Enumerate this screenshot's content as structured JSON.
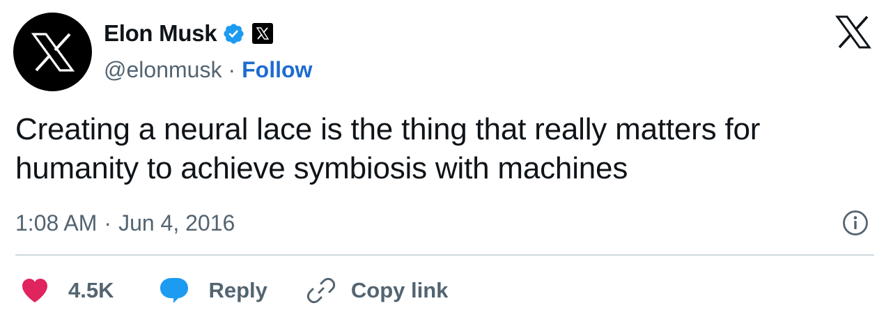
{
  "author": {
    "name": "Elon Musk",
    "handle": "@elonmusk",
    "separator": "·",
    "follow_label": "Follow",
    "verified_icon": "verified-badge-icon",
    "affiliation_icon": "x-affiliation-badge-icon",
    "avatar_icon": "x-logo-icon"
  },
  "tweet": {
    "text": "Creating a neural lace is the thing that really matters for humanity to achieve symbiosis with machines",
    "time": "1:08 AM",
    "separator": "·",
    "date": "Jun 4, 2016"
  },
  "actions": {
    "likes": "4.5K",
    "reply_label": "Reply",
    "copy_link_label": "Copy link"
  },
  "colors": {
    "like": "#e0245e",
    "reply": "#1d9bf0",
    "follow": "#1d6cd0",
    "verified": "#1d9bf0",
    "secondary_text": "#536471"
  },
  "icons": {
    "top_right": "x-logo-icon",
    "info": "info-icon",
    "like": "heart-icon",
    "reply": "speech-bubble-icon",
    "copy": "link-icon"
  }
}
